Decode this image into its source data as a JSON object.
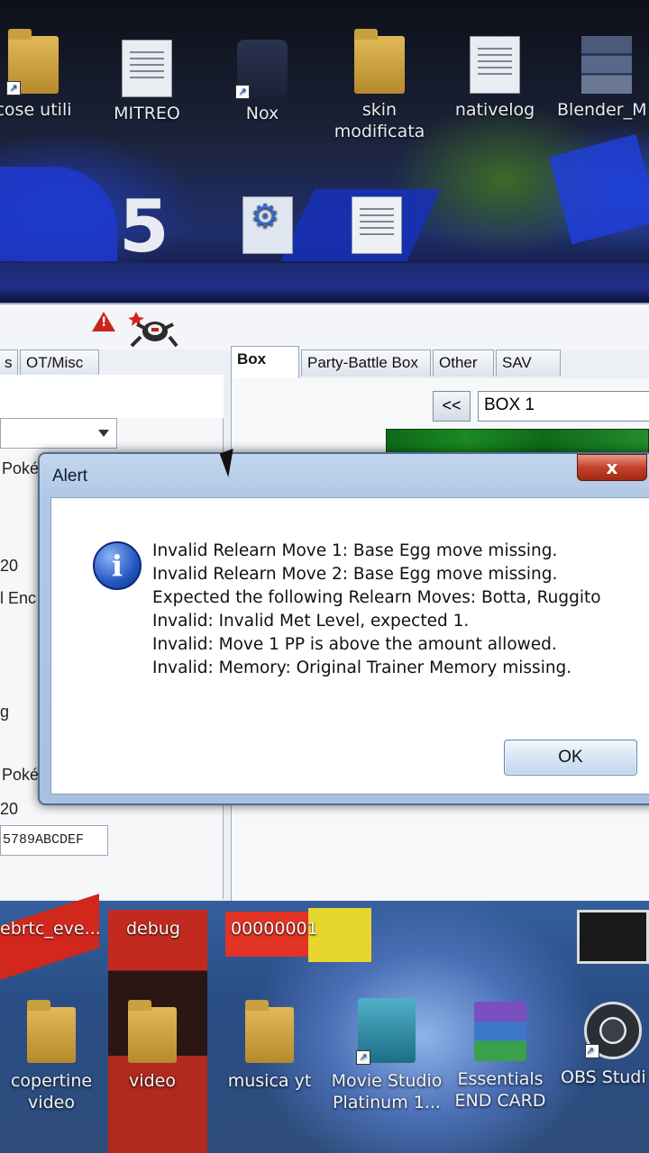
{
  "desktop_top": {
    "icons": [
      {
        "label": "cose utili",
        "kind": "folder"
      },
      {
        "label": "MITREO",
        "kind": "doc"
      },
      {
        "label": "Nox",
        "kind": "app"
      },
      {
        "label": "skin modificata",
        "kind": "folder"
      },
      {
        "label": "nativelog",
        "kind": "doc"
      },
      {
        "label": "Blender_M",
        "kind": "stack"
      }
    ],
    "wallpaper_number": "5"
  },
  "app": {
    "tabs_left": [
      {
        "label": "s"
      },
      {
        "label": "OT/Misc"
      }
    ],
    "tabs_right": [
      {
        "label": "Box",
        "active": true
      },
      {
        "label": "Party-Battle Box"
      },
      {
        "label": "Other"
      },
      {
        "label": "SAV"
      }
    ],
    "box_prev_label": "<<",
    "box_name": "BOX 1",
    "left_fragments": [
      "Poké",
      "20",
      "l Enc",
      "g",
      "Poké",
      "20"
    ],
    "hex_value": "5789ABCDEF"
  },
  "alert": {
    "title": "Alert",
    "close_label": "x",
    "messages": [
      "Invalid Relearn Move 1: Base Egg move missing.",
      "Invalid Relearn Move 2: Base Egg move missing.",
      "Expected the following Relearn Moves: Botta, Ruggito",
      "Invalid: Invalid Met Level, expected 1.",
      "Invalid: Move 1 PP is above the amount allowed.",
      "Invalid: Memory: Original Trainer Memory missing."
    ],
    "ok_label": "OK"
  },
  "desktop_bottom": {
    "file_labels": [
      "ebrtc_eve...",
      "debug",
      "00000001"
    ],
    "icons": [
      {
        "label": "copertine video"
      },
      {
        "label": "video"
      },
      {
        "label": "musica yt"
      },
      {
        "label": "Movie Studio Platinum 1..."
      },
      {
        "label": "Essentials END CARD"
      },
      {
        "label": "OBS Studi"
      }
    ]
  }
}
